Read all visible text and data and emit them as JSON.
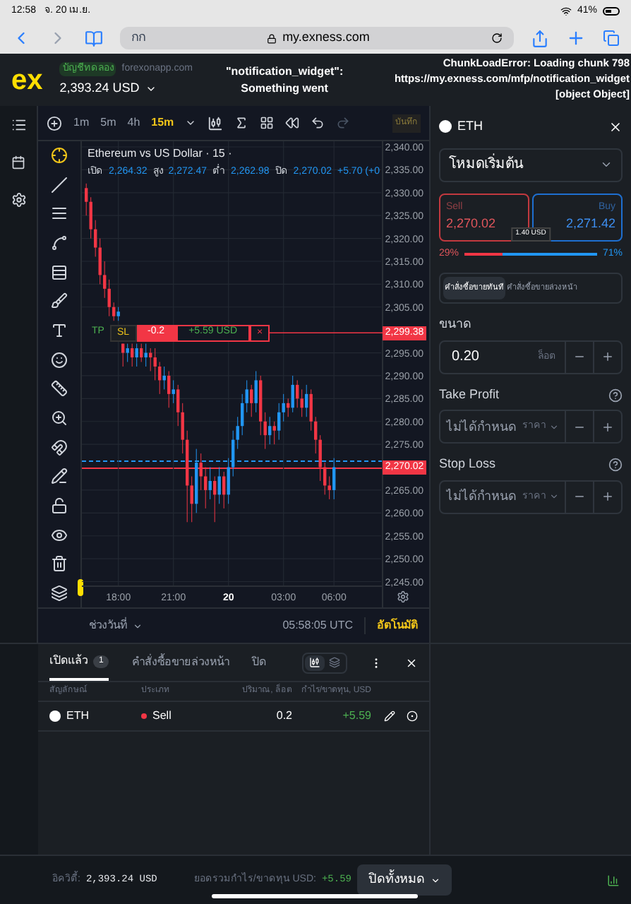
{
  "status_bar": {
    "time": "12:58",
    "date": "จ. 20 เม.ย.",
    "battery": "41%"
  },
  "browser": {
    "text_size": "กก",
    "url": "my.exness.com"
  },
  "header": {
    "logo": "ex",
    "account_badge": "บัญชีทดลอง",
    "server": "forexonapp.com",
    "balance": "2,393.24 USD"
  },
  "error_overlay": {
    "widget_error": [
      "\"notification_widget\":",
      "Something went"
    ],
    "chunk_error": [
      "ChunkLoadError: Loading chunk 798",
      "https://my.exness.com/mfp/notification_widget",
      "[object Object]"
    ]
  },
  "chart_toolbar": {
    "timeframes": [
      {
        "label": "1m",
        "selected": false
      },
      {
        "label": "5m",
        "selected": false
      },
      {
        "label": "4h",
        "selected": false
      },
      {
        "label": "15m",
        "selected": true
      }
    ],
    "save": "บันทึก"
  },
  "chart": {
    "title": "Ethereum vs US Dollar · 15 ·",
    "ohlc": [
      {
        "label": "เปิด",
        "value": "2,264.32"
      },
      {
        "label": "สูง",
        "value": "2,272.47"
      },
      {
        "label": "ต่ำ",
        "value": "2,262.98"
      },
      {
        "label": "ปิด",
        "value": "2,270.02"
      }
    ],
    "change": "+5.70 (+0",
    "chart_data": {
      "type": "candlestick",
      "categories": [
        null,
        null,
        null,
        null,
        null,
        null,
        null,
        "18:00",
        null,
        null,
        null,
        null,
        null,
        null,
        null,
        null,
        null,
        null,
        null,
        "21:00",
        null,
        null,
        null,
        null,
        null,
        null,
        null,
        null,
        null,
        null,
        null,
        "20",
        null,
        null,
        null,
        null,
        null,
        null,
        null,
        null,
        null,
        null,
        null,
        "03:00",
        null,
        null,
        null,
        null,
        null,
        null,
        null,
        null,
        null,
        null,
        "06:00"
      ],
      "ohlc": [
        [
          2331,
          2332,
          2325,
          2328
        ],
        [
          2328,
          2329,
          2320,
          2322
        ],
        [
          2322,
          2324,
          2316,
          2318
        ],
        [
          2318,
          2320,
          2310,
          2312
        ],
        [
          2312,
          2315,
          2307,
          2309
        ],
        [
          2309,
          2311,
          2303,
          2305
        ],
        [
          2305,
          2306,
          2302,
          2303
        ],
        [
          2303,
          2305,
          2302,
          2304
        ],
        [
          2297,
          2297,
          2292,
          2295
        ],
        [
          2295,
          2297,
          2293,
          2296
        ],
        [
          2296,
          2297,
          2292,
          2294
        ],
        [
          2294,
          2297,
          2292,
          2296
        ],
        [
          2296,
          2297,
          2293,
          2294
        ],
        [
          2294,
          2297,
          2292,
          2295
        ],
        [
          2295,
          2296,
          2291,
          2294
        ],
        [
          2294,
          2296,
          2289,
          2292
        ],
        [
          2292,
          2293,
          2286,
          2289
        ],
        [
          2289,
          2292,
          2287,
          2290
        ],
        [
          2290,
          2291,
          2283,
          2286
        ],
        [
          2286,
          2289,
          2284,
          2287
        ],
        [
          2287,
          2288,
          2279,
          2282
        ],
        [
          2282,
          2284,
          2273,
          2276
        ],
        [
          2276,
          2278,
          2258,
          2266
        ],
        [
          2266,
          2268,
          2258,
          2262
        ],
        [
          2262,
          2274,
          2260,
          2271
        ],
        [
          2271,
          2273,
          2265,
          2268
        ],
        [
          2268,
          2270,
          2261,
          2265
        ],
        [
          2265,
          2270,
          2263,
          2267
        ],
        [
          2267,
          2268,
          2258,
          2264
        ],
        [
          2264,
          2270,
          2262,
          2268
        ],
        [
          2268,
          2269,
          2261,
          2264
        ],
        [
          2264,
          2272,
          2262,
          2270
        ],
        [
          2270,
          2278,
          2268,
          2276
        ],
        [
          2276,
          2281,
          2274,
          2279
        ],
        [
          2279,
          2286,
          2277,
          2284
        ],
        [
          2284,
          2289,
          2282,
          2287
        ],
        [
          2287,
          2288,
          2281,
          2284
        ],
        [
          2284,
          2291,
          2282,
          2289
        ],
        [
          2289,
          2290,
          2277,
          2280
        ],
        [
          2280,
          2282,
          2274,
          2277
        ],
        [
          2277,
          2281,
          2275,
          2279
        ],
        [
          2279,
          2280,
          2275,
          2278
        ],
        [
          2278,
          2284,
          2276,
          2282
        ],
        [
          2282,
          2286,
          2280,
          2284
        ],
        [
          2284,
          2285,
          2281,
          2283
        ],
        [
          2283,
          2290,
          2282,
          2288
        ],
        [
          2288,
          2289,
          2283,
          2285
        ],
        [
          2285,
          2287,
          2281,
          2283
        ],
        [
          2283,
          2288,
          2281,
          2286
        ],
        [
          2286,
          2287,
          2278,
          2280
        ],
        [
          2280,
          2281,
          2273,
          2276
        ],
        [
          2276,
          2277,
          2267,
          2270
        ],
        [
          2270,
          2271,
          2264,
          2266
        ],
        [
          2266,
          2268,
          2263,
          2265
        ],
        [
          2265,
          2272,
          2263,
          2270
        ]
      ],
      "ylim": [
        2244,
        2340
      ],
      "grid": true,
      "yticks": [
        {
          "value": 2340,
          "label": "2,340.00"
        },
        {
          "value": 2335,
          "label": "2,335.00"
        },
        {
          "value": 2330,
          "label": "2,330.00"
        },
        {
          "value": 2325,
          "label": "2,325.00"
        },
        {
          "value": 2320,
          "label": "2,320.00"
        },
        {
          "value": 2315,
          "label": "2,315.00"
        },
        {
          "value": 2310,
          "label": "2,310.00"
        },
        {
          "value": 2305,
          "label": "2,305.00"
        },
        {
          "value": 2295,
          "label": "2,295.00"
        },
        {
          "value": 2290,
          "label": "2,290.00"
        },
        {
          "value": 2285,
          "label": "2,285.00"
        },
        {
          "value": 2280,
          "label": "2,280.00"
        },
        {
          "value": 2275,
          "label": "2,275.00"
        },
        {
          "value": 2265,
          "label": "2,265.00"
        },
        {
          "value": 2260,
          "label": "2,260.00"
        },
        {
          "value": 2255,
          "label": "2,255.00"
        },
        {
          "value": 2250,
          "label": "2,250.00"
        },
        {
          "value": 2245,
          "label": "2,245.00"
        }
      ]
    },
    "time_axis": [
      {
        "kind": "time"
      },
      {
        "kind": "time"
      },
      {
        "kind": "day"
      },
      {
        "kind": "time"
      },
      {
        "kind": "time"
      }
    ],
    "order_line": {
      "tp": "TP",
      "sl": "SL",
      "volume": "-0.2",
      "profit": "+5.59 USD",
      "close": "×",
      "price": "2,299.38"
    },
    "current_price": "2,270.02"
  },
  "chart_footer": {
    "date_range": "ช่วงวันที่",
    "clock": "05:58:05 UTC",
    "auto": "อัตโนมัติ"
  },
  "order_panel": {
    "symbol": "ETH",
    "mode": "โหมดเริ่มต้น",
    "sell": {
      "label": "Sell",
      "price": "2,270.02"
    },
    "buy": {
      "label": "Buy",
      "price": "2,271.42"
    },
    "spread": "1.40 USD",
    "sell_share": "29%",
    "buy_share": "71%",
    "sentiment": {
      "level": 0.29
    },
    "tabs": [
      {
        "label": "คำสั่งซื้อขายทันที",
        "selected": true
      },
      {
        "label": "คำสั่งซื้อขายล่วงหน้า",
        "selected": false
      }
    ],
    "volume": {
      "label": "ขนาด",
      "value": "0.20",
      "unit": "ล็อต"
    },
    "take_profit": {
      "label": "Take Profit",
      "placeholder": "ไม่ได้กำหนด",
      "unit": "ราคา"
    },
    "stop_loss": {
      "label": "Stop Loss",
      "placeholder": "ไม่ได้กำหนด",
      "unit": "ราคา"
    }
  },
  "positions": {
    "tabs": [
      {
        "label": "เปิดแล้ว",
        "count": "1",
        "selected": true
      },
      {
        "label": "คำสั่งซื้อขายล่วงหน้า",
        "selected": false
      },
      {
        "label": "ปิด",
        "selected": false
      }
    ],
    "view_toggle": [
      {
        "kind": "chart",
        "selected": true
      },
      {
        "kind": "list",
        "selected": false
      }
    ],
    "columns": [
      "สัญลักษณ์",
      "ประเภท",
      "ปริมาณ, ล็อต",
      "กำไร/ขาดทุน, USD"
    ],
    "rows": [
      {
        "symbol": "ETH",
        "type": "Sell",
        "color": "#f23645",
        "volume": "0.2",
        "profit": "+5.59"
      }
    ]
  },
  "footer": {
    "equity_label": "อิควิตี้:",
    "equity": "2,393.24 USD",
    "pl_label": "ยอดรวมกำไร/ขาดทุน USD:",
    "pl": "+5.59",
    "close_all": "ปิดทั้งหมด"
  }
}
